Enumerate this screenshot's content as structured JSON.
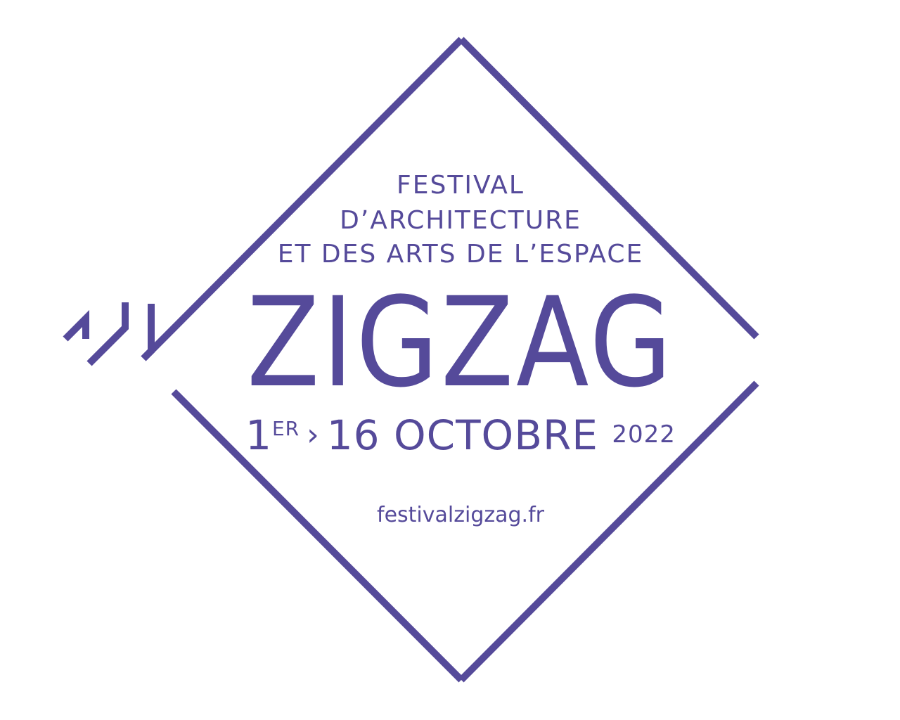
{
  "poster": {
    "line1": "FESTIVAL",
    "line2": "D’ARCHITECTURE",
    "line3": "ET DES ARTS DE L’ESPACE",
    "title": "ZIGZAG",
    "dates": {
      "day_start": "1",
      "day_start_suffix": "ER",
      "separator": "›",
      "day_end_month": "16 OCTOBRE",
      "year": "2022"
    },
    "url": "festivalzigzag.fr"
  },
  "colors": {
    "accent": "#554a9a",
    "background": "#ffffff"
  },
  "icons": {
    "frame": "diamond-frame-icon",
    "mark": "zigzag-mark-icon"
  }
}
